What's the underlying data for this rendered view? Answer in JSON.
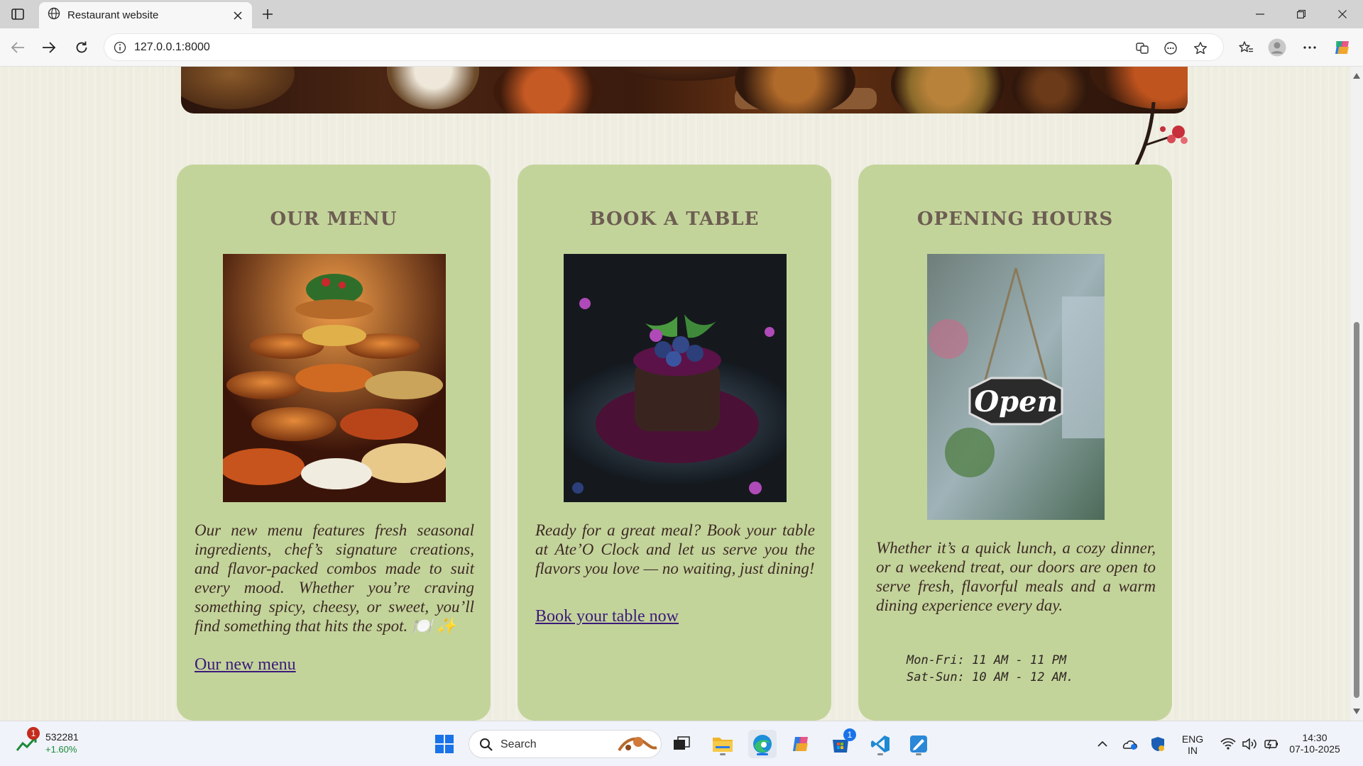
{
  "browser": {
    "tab_title": "Restaurant website",
    "url": "127.0.0.1:8000"
  },
  "cards": [
    {
      "title": "OUR MENU",
      "description": "Our new menu features fresh seasonal ingredients, chef’s signature creations, and flavor-packed combos made to suit every mood. Whether you’re craving something spicy, cheesy, or sweet, you’ll find something that hits the spot. 🍽️ ✨",
      "link": "Our new menu"
    },
    {
      "title": "BOOK A TABLE",
      "description": "Ready for a great meal? Book your table at Ate’O Clock and let us serve you the flavors you love — no waiting, just dining!",
      "link": "Book your table now"
    },
    {
      "title": "OPENING HOURS",
      "description": "Whether it’s a quick lunch, a cozy dinner, or a weekend treat, our doors are open to serve fresh, flavorful meals and a warm dining experience every day.",
      "sign_text": "Open",
      "hours": [
        "Mon-Fri: 11 AM - 11 PM",
        "Sat-Sun: 10 AM - 12 AM."
      ]
    }
  ],
  "taskbar": {
    "stock_value": "532281",
    "stock_change": "+1.60%",
    "stock_badge": "1",
    "search_placeholder": "Search",
    "store_badge": "1",
    "language": "ENG",
    "region": "IN",
    "time": "14:30",
    "date": "07-10-2025"
  },
  "colors": {
    "card_bg": "#c3d49b",
    "heading": "#6d5d52",
    "link": "#3c1a7a",
    "page_bg": "#eeede0"
  }
}
